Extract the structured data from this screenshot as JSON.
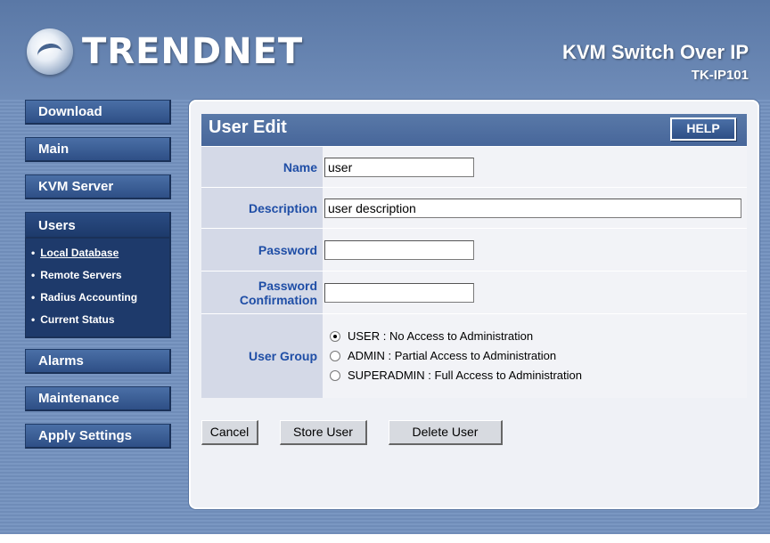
{
  "brand": {
    "logo_text": "TRENDNET"
  },
  "product": {
    "title": "KVM Switch Over IP",
    "model": "TK-IP101"
  },
  "nav": {
    "download": "Download",
    "main": "Main",
    "kvm_server": "KVM Server",
    "users": "Users",
    "users_sub": [
      "Local Database",
      "Remote Servers",
      "Radius Accounting",
      "Current Status"
    ],
    "alarms": "Alarms",
    "maintenance": "Maintenance",
    "apply_settings": "Apply Settings"
  },
  "panel": {
    "title": "User Edit",
    "help": "HELP"
  },
  "form": {
    "name_label": "Name",
    "name_value": "user",
    "description_label": "Description",
    "description_value": "user description",
    "password_label": "Password",
    "password_value": "",
    "password_confirm_label_1": "Password",
    "password_confirm_label_2": "Confirmation",
    "password_confirm_value": "",
    "user_group_label": "User Group",
    "groups": [
      {
        "label": "USER : No Access to Administration",
        "selected": true
      },
      {
        "label": "ADMIN : Partial Access to Administration",
        "selected": false
      },
      {
        "label": "SUPERADMIN : Full Access to Administration",
        "selected": false
      }
    ]
  },
  "actions": {
    "cancel": "Cancel",
    "store": "Store User",
    "delete": "Delete User"
  },
  "colors": {
    "frame": "#6f8cb8",
    "nav_button": "#2e4f86",
    "label_text": "#1f4ea6",
    "label_bg": "#d4d9e7"
  }
}
